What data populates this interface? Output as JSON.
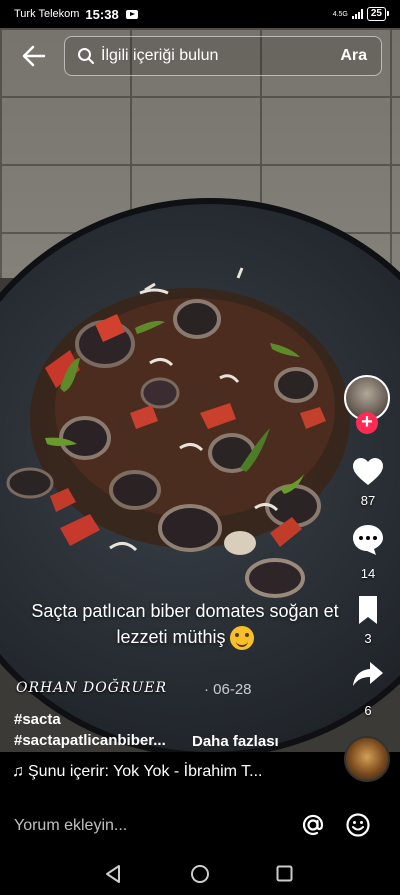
{
  "status_bar": {
    "carrier": "Turk Telekom",
    "time": "15:38",
    "network": "4.5G",
    "battery": "25"
  },
  "search": {
    "placeholder": "İlgili içeriği bulun",
    "button": "Ara"
  },
  "video": {
    "caption_line1": "Saçta patlıcan biber domates soğan et",
    "caption_line2": "lezzeti müthiş",
    "author": "ORHAN DOĞRUER",
    "date": "· 06-28",
    "hashtag1": "#sacta",
    "hashtag2": "#sactapatlicanbiber...",
    "more": "Daha fazlası"
  },
  "actions": {
    "likes": "87",
    "comments": "14",
    "saves": "3",
    "shares": "6"
  },
  "music": {
    "text": "Şunu içerir: Yok Yok - İbrahim T..."
  },
  "comment_bar": {
    "placeholder": "Yorum ekleyin..."
  },
  "colors": {
    "follow": "#fe2c55",
    "background": "#000000"
  }
}
